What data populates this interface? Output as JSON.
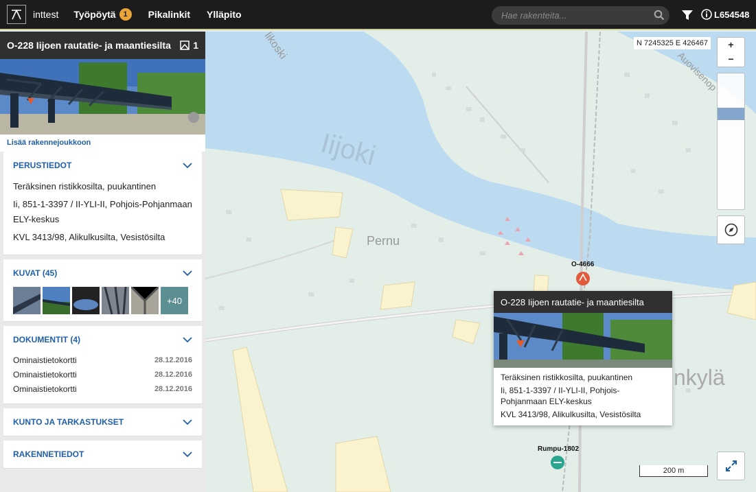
{
  "app": {
    "name": "inttest"
  },
  "nav": {
    "workdesk": "Työpöytä",
    "workdesk_badge": "1",
    "quicklinks": "Pikalinkit",
    "maintenance": "Ylläpito"
  },
  "search": {
    "placeholder": "Hae rakenteita..."
  },
  "user": {
    "id": "L654548"
  },
  "structure": {
    "title": "O-228 Iijoen rautatie- ja maantiesilta",
    "image_count": "1",
    "add_link": "Lisää rakennejoukkoon"
  },
  "sections": {
    "basic": {
      "title": "PERUSTIEDOT",
      "line1": "Teräksinen ristikkosilta, puukantinen",
      "line2": "Ii, 851-1-3397 / II-YLI-II, Pohjois-Pohjanmaan ELY-keskus",
      "line3": "KVL 3413/98, Alikulkusilta, Vesistösilta"
    },
    "images": {
      "title": "KUVAT (45)",
      "more": "+40"
    },
    "documents": {
      "title": "DOKUMENTIT (4)",
      "rows": [
        {
          "name": "Ominaistietokortti",
          "date": "28.12.2016"
        },
        {
          "name": "Ominaistietokortti",
          "date": "28.12.2016"
        },
        {
          "name": "Ominaistietokortti",
          "date": "28.12.2016"
        }
      ]
    },
    "condition": {
      "title": "KUNTO JA TARKASTUKSET"
    },
    "structure_data": {
      "title": "RAKENNETIEDOT"
    }
  },
  "map": {
    "coordinates": "N 7245325 E 426467",
    "zoom_in": "+",
    "zoom_out": "−",
    "scale": "200 m",
    "label_river": "Iijoki",
    "label_pernu": "Pernu",
    "label_kyla": "nkylä",
    "label_road": "Auovisenop",
    "label_alikoski": "likoski",
    "marker1": "O-4666",
    "marker2": "Rumpu-1802"
  },
  "popup": {
    "title": "O-228 Iijoen rautatie- ja maantiesilta",
    "line1": "Teräksinen ristikkosilta, puukantinen",
    "line2": "Ii, 851-1-3397 / II-YLI-II, Pohjois-Pohjanmaan ELY-keskus",
    "line3": "KVL 3413/98, Alikulkusilta, Vesistösilta"
  }
}
